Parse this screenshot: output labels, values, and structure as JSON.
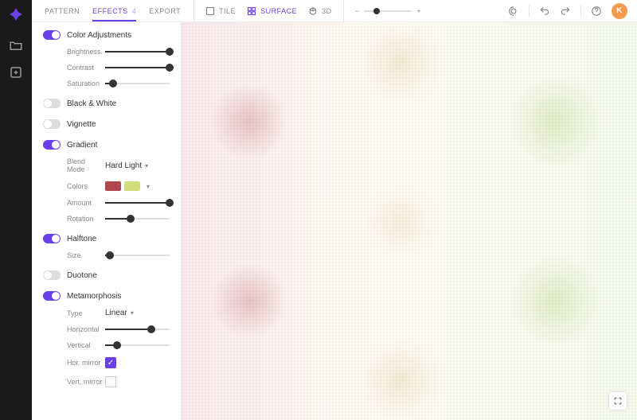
{
  "tabs": {
    "pattern": "PATTERN",
    "effects": "EFFECTS",
    "effects_badge": "4",
    "export": "EXPORT"
  },
  "view": {
    "tile": "TILE",
    "surface": "SURFACE",
    "threeD": "3D"
  },
  "avatar_initial": "K",
  "effects": {
    "color_adjustments": {
      "title": "Color Adjustments",
      "brightness": {
        "label": "Brightness",
        "pct": 100
      },
      "contrast": {
        "label": "Contrast",
        "pct": 100
      },
      "saturation": {
        "label": "Saturation",
        "pct": 12
      }
    },
    "black_white": {
      "title": "Black & White"
    },
    "vignette": {
      "title": "Vignette"
    },
    "gradient": {
      "title": "Gradient",
      "blend_mode": {
        "label": "Blend Mode",
        "value": "Hard Light"
      },
      "colors_label": "Colors",
      "amount": {
        "label": "Amount",
        "pct": 100
      },
      "rotation": {
        "label": "Rotation",
        "pct": 40
      }
    },
    "halftone": {
      "title": "Halftone",
      "size": {
        "label": "Size",
        "pct": 8
      }
    },
    "duotone": {
      "title": "Duotone"
    },
    "metamorphosis": {
      "title": "Metamorphosis",
      "type": {
        "label": "Type",
        "value": "Linear"
      },
      "horizontal": {
        "label": "Horizontal",
        "pct": 72
      },
      "vertical": {
        "label": "Vertical",
        "pct": 18
      },
      "hor_mirror": {
        "label": "Hor. mirror",
        "checked": true
      },
      "vert_mirror": {
        "label": "Vert. mirror",
        "checked": false
      }
    }
  }
}
